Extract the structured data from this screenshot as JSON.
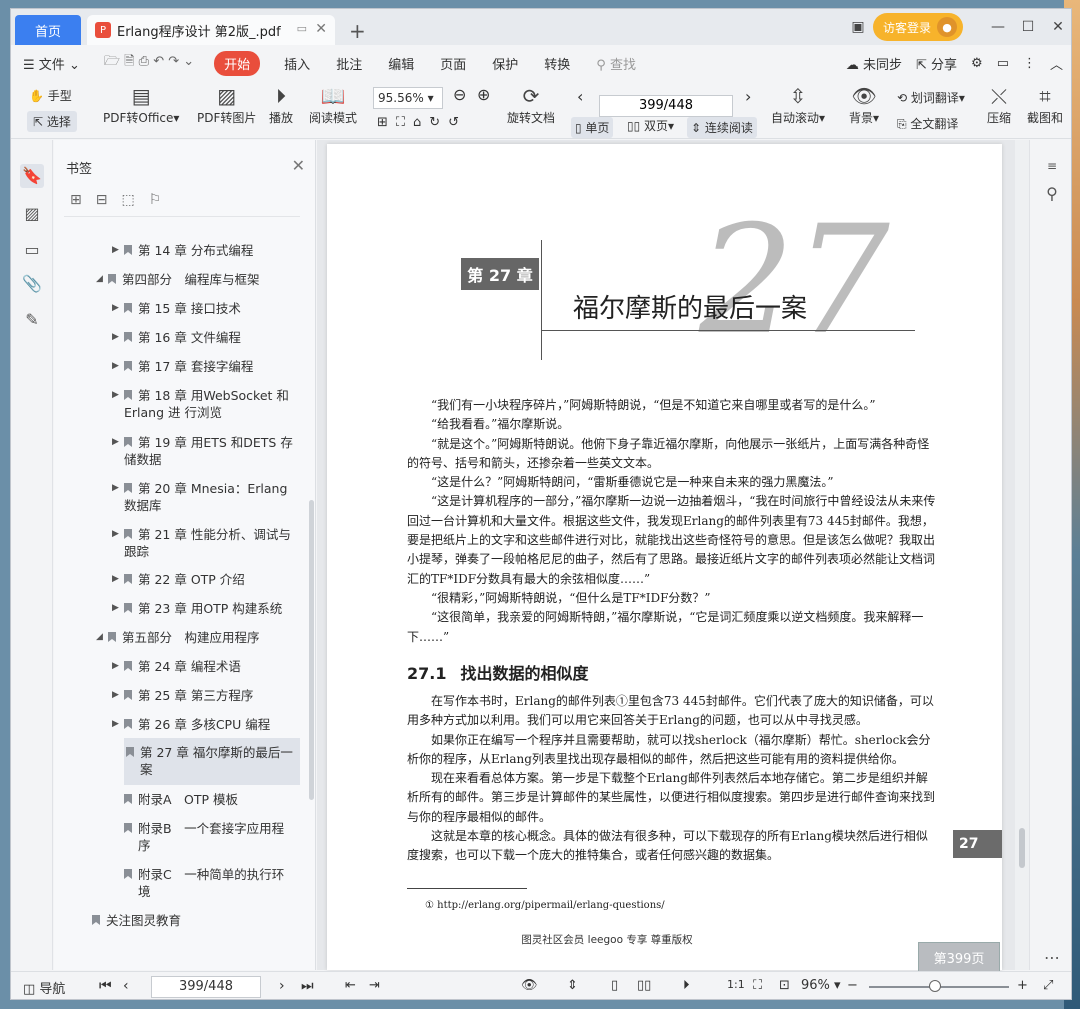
{
  "titlebar": {
    "home_tab": "首页",
    "doc_tab": "Erlang程序设计 第2版_.pdf",
    "visitor": "访客登录"
  },
  "menu": {
    "file": "文件",
    "items": [
      "开始",
      "插入",
      "批注",
      "编辑",
      "页面",
      "保护",
      "转换"
    ],
    "search": "查找",
    "unsync": "未同步",
    "share": "分享"
  },
  "toolbar": {
    "hand": "手型",
    "select": "选择",
    "pdf_office": "PDF转Office",
    "pdf_image": "PDF转图片",
    "play": "播放",
    "read_mode": "阅读模式",
    "zoom": "95.56%",
    "page": "399/448",
    "rotate": "旋转文档",
    "single": "单页",
    "double": "双页",
    "continuous": "连续阅读",
    "autoscroll": "自动滚动",
    "background": "背景",
    "word_translate": "划词翻译",
    "full_translate": "全文翻译",
    "compress": "压缩",
    "screenshot": "截图和"
  },
  "panel": {
    "title": "书签",
    "items": [
      {
        "label": "第 14 章 分布式编程"
      },
      {
        "label": "第四部分　编程库与框架"
      },
      {
        "label": "第 15 章 接口技术"
      },
      {
        "label": "第 16 章 文件编程"
      },
      {
        "label": "第 17 章 套接字编程"
      },
      {
        "label": "第 18 章 用WebSocket 和",
        "label2": "Erlang 进 行浏览"
      },
      {
        "label": "第 19 章 用ETS 和DETS 存",
        "label2": "储数据"
      },
      {
        "label": "第 20 章 Mnesia：Erlang",
        "label2": "数据库"
      },
      {
        "label": "第 21 章 性能分析、调试与",
        "label2": "跟踪"
      },
      {
        "label": "第 22 章 OTP 介绍"
      },
      {
        "label": "第 23 章 用OTP 构建系统"
      },
      {
        "label": "第五部分　构建应用程序"
      },
      {
        "label": "第 24 章 编程术语"
      },
      {
        "label": "第 25 章 第三方程序"
      },
      {
        "label": "第 26 章 多核CPU 编程"
      },
      {
        "label": "第 27 章 福尔摩斯的最后一",
        "label2": "案"
      },
      {
        "label": "附录A　OTP 模板"
      },
      {
        "label": "附录B　一个套接字应用程",
        "label2": "序"
      },
      {
        "label": "附录C　一种简单的执行环",
        "label2": "境"
      },
      {
        "label": "关注图灵教育"
      }
    ]
  },
  "page": {
    "chapter_badge": "第 27 章",
    "chapter_number": "27",
    "chapter_title": "福尔摩斯的最后一案",
    "paragraphs": [
      "　　“我们有一小块程序碎片，”阿姆斯特朗说，“但是不知道它来自哪里或者写的是什么。”",
      "　　“给我看看。”福尔摩斯说。",
      "　　“就是这个。”阿姆斯特朗说。他俯下身子靠近福尔摩斯，向他展示一张纸片，上面写满各种奇怪的符号、括号和箭头，还掺杂着一些英文文本。",
      "　　“这是什么？”阿姆斯特朗问，“雷斯垂德说它是一种来自未来的强力黑魔法。”",
      "　　“这是计算机程序的一部分，”福尔摩斯一边说一边抽着烟斗，“我在时间旅行中曾经设法从未来传回过一台计算机和大量文件。根据这些文件，我发现Erlang的邮件列表里有73 445封邮件。我想，要是把纸片上的文字和这些邮件进行对比，就能找出这些奇怪符号的意思。但是该怎么做呢？我取出小提琴，弹奏了一段帕格尼尼的曲子，然后有了思路。最接近纸片文字的邮件列表项必然能让文档词汇的TF*IDF分数具有最大的余弦相似度……”",
      "　　“很精彩，”阿姆斯特朗说，“但什么是TF*IDF分数？”",
      "　　“这很简单，我亲爱的阿姆斯特朗，”福尔摩斯说，“它是词汇频度乘以逆文档频度。我来解释一下……”"
    ],
    "section_number": "27.1",
    "section_title": "找出数据的相似度",
    "body": [
      "　　在写作本书时，Erlang的邮件列表①里包含73 445封邮件。它们代表了庞大的知识储备，可以用多种方式加以利用。我们可以用它来回答关于Erlang的问题，也可以从中寻找灵感。",
      "　　如果你正在编写一个程序并且需要帮助，就可以找sherlock（福尔摩斯）帮忙。sherlock会分析你的程序，从Erlang列表里找出现存最相似的邮件，然后把这些可能有用的资料提供给你。",
      "　　现在来看看总体方案。第一步是下载整个Erlang邮件列表然后本地存储它。第二步是组织并解析所有的邮件。第三步是计算邮件的某些属性，以便进行相似度搜索。第四步是进行邮件查询来找到与你的程序最相似的邮件。",
      "　　这就是本章的核心概念。具体的做法有很多种，可以下载现存的所有Erlang模块然后进行相似度搜索，也可以下载一个庞大的推特集合，或者任何感兴趣的数据集。"
    ],
    "footnote": "① http://erlang.org/pipermail/erlang-questions/",
    "watermark": "图灵社区会员 leegoo 专享 尊重版权",
    "side_tab": "27",
    "page_badge": "第399页"
  },
  "status": {
    "nav": "导航",
    "page": "399/448",
    "zoom": "96%"
  }
}
